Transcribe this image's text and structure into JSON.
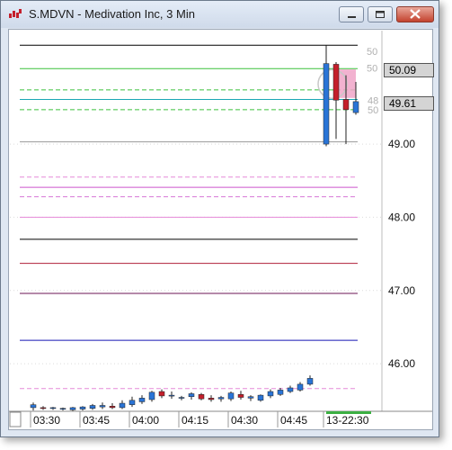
{
  "window": {
    "title": "S.MDVN - Medivation Inc, 3 Min"
  },
  "colors": {
    "up_candle": "#2a74d6",
    "down_candle": "#c41f2b",
    "pink_fill": "#f0a4c8",
    "grid": "#dcdcdc"
  },
  "chart_data": {
    "type": "candlestick",
    "title": "S.MDVN - Medivation Inc, 3 Min",
    "ylim": [
      45.35,
      50.55
    ],
    "y_ticks": [
      "46.00",
      "47.00",
      "48.00",
      "49.00"
    ],
    "x_ticks": [
      "03:30",
      "03:45",
      "04:00",
      "04:15",
      "04:30",
      "04:45",
      "13-22:30"
    ],
    "price_labels": [
      "50.09",
      "49.61"
    ],
    "faded_labels": [
      "50",
      "50",
      "48",
      "50"
    ],
    "horizontal_lines": [
      {
        "price": 50.35,
        "color": "#000000",
        "style": "solid"
      },
      {
        "price": 50.03,
        "color": "#3cc13c",
        "style": "solid"
      },
      {
        "price": 49.74,
        "color": "#3cc13c",
        "style": "dashed"
      },
      {
        "price": 49.61,
        "color": "#1aa7b5",
        "style": "solid"
      },
      {
        "price": 49.47,
        "color": "#3cc13c",
        "style": "dashed"
      },
      {
        "price": 49.03,
        "color": "#9a9a9a",
        "style": "solid"
      },
      {
        "price": 48.55,
        "color": "#e68ad8",
        "style": "dashed"
      },
      {
        "price": 48.41,
        "color": "#cc55cc",
        "style": "solid"
      },
      {
        "price": 48.28,
        "color": "#d877d8",
        "style": "dashed"
      },
      {
        "price": 48.0,
        "color": "#e68ad8",
        "style": "solid"
      },
      {
        "price": 47.7,
        "color": "#000000",
        "style": "solid"
      },
      {
        "price": 47.37,
        "color": "#b0203a",
        "style": "solid"
      },
      {
        "price": 46.96,
        "color": "#6b1456",
        "style": "solid"
      },
      {
        "price": 46.32,
        "color": "#1414b4",
        "style": "solid"
      },
      {
        "price": 45.66,
        "color": "#e68ad8",
        "style": "dashed"
      }
    ],
    "candles": [
      {
        "t": "03:30",
        "o": 45.4,
        "h": 45.47,
        "l": 45.36,
        "c": 45.44
      },
      {
        "t": "03:33",
        "o": 45.4,
        "h": 45.42,
        "l": 45.37,
        "c": 45.39
      },
      {
        "t": "03:36",
        "o": 45.39,
        "h": 45.41,
        "l": 45.37,
        "c": 45.4
      },
      {
        "t": "03:39",
        "o": 45.38,
        "h": 45.4,
        "l": 45.36,
        "c": 45.39
      },
      {
        "t": "03:42",
        "o": 45.37,
        "h": 45.41,
        "l": 45.35,
        "c": 45.4
      },
      {
        "t": "03:45",
        "o": 45.38,
        "h": 45.42,
        "l": 45.36,
        "c": 45.41
      },
      {
        "t": "03:48",
        "o": 45.39,
        "h": 45.45,
        "l": 45.37,
        "c": 45.43
      },
      {
        "t": "03:51",
        "o": 45.41,
        "h": 45.47,
        "l": 45.38,
        "c": 45.43
      },
      {
        "t": "03:54",
        "o": 45.42,
        "h": 45.46,
        "l": 45.38,
        "c": 45.4
      },
      {
        "t": "03:57",
        "o": 45.4,
        "h": 45.5,
        "l": 45.38,
        "c": 45.46
      },
      {
        "t": "04:00",
        "o": 45.44,
        "h": 45.55,
        "l": 45.41,
        "c": 45.5
      },
      {
        "t": "04:03",
        "o": 45.48,
        "h": 45.57,
        "l": 45.45,
        "c": 45.53
      },
      {
        "t": "04:06",
        "o": 45.51,
        "h": 45.63,
        "l": 45.48,
        "c": 45.61
      },
      {
        "t": "04:09",
        "o": 45.62,
        "h": 45.65,
        "l": 45.53,
        "c": 45.56
      },
      {
        "t": "04:12",
        "o": 45.56,
        "h": 45.62,
        "l": 45.52,
        "c": 45.57
      },
      {
        "t": "04:15",
        "o": 45.53,
        "h": 45.56,
        "l": 45.5,
        "c": 45.54
      },
      {
        "t": "04:18",
        "o": 45.55,
        "h": 45.61,
        "l": 45.51,
        "c": 45.59
      },
      {
        "t": "04:21",
        "o": 45.58,
        "h": 45.6,
        "l": 45.5,
        "c": 45.52
      },
      {
        "t": "04:24",
        "o": 45.53,
        "h": 45.57,
        "l": 45.48,
        "c": 45.51
      },
      {
        "t": "04:27",
        "o": 45.52,
        "h": 45.56,
        "l": 45.48,
        "c": 45.54
      },
      {
        "t": "04:30",
        "o": 45.52,
        "h": 45.62,
        "l": 45.49,
        "c": 45.6
      },
      {
        "t": "04:33",
        "o": 45.58,
        "h": 45.63,
        "l": 45.51,
        "c": 45.54
      },
      {
        "t": "04:36",
        "o": 45.53,
        "h": 45.57,
        "l": 45.49,
        "c": 45.55
      },
      {
        "t": "04:39",
        "o": 45.5,
        "h": 45.58,
        "l": 45.48,
        "c": 45.57
      },
      {
        "t": "04:42",
        "o": 45.56,
        "h": 45.65,
        "l": 45.53,
        "c": 45.62
      },
      {
        "t": "04:45",
        "o": 45.58,
        "h": 45.67,
        "l": 45.56,
        "c": 45.64
      },
      {
        "t": "04:48",
        "o": 45.62,
        "h": 45.7,
        "l": 45.6,
        "c": 45.67
      },
      {
        "t": "04:51",
        "o": 45.64,
        "h": 45.75,
        "l": 45.62,
        "c": 45.72
      },
      {
        "t": "04:54",
        "o": 45.72,
        "h": 45.84,
        "l": 45.7,
        "c": 45.8
      },
      {
        "t": "13-22:30",
        "o": 49.0,
        "h": 50.35,
        "l": 48.97,
        "c": 50.1
      },
      {
        "t": "13-22:33",
        "o": 50.09,
        "h": 50.12,
        "l": 49.07,
        "c": 49.6
      },
      {
        "t": "13-22:36",
        "o": 49.61,
        "h": 49.94,
        "l": 49.0,
        "c": 49.47
      },
      {
        "t": "13-22:39",
        "o": 49.43,
        "h": 49.85,
        "l": 49.4,
        "c": 49.58
      }
    ]
  }
}
